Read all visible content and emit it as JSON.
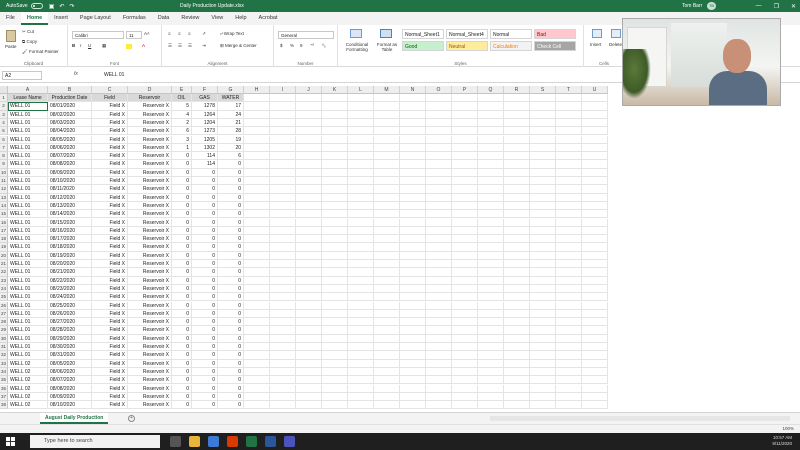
{
  "window": {
    "autosave_label": "AutoSave",
    "autosave_state": "Off",
    "doc_title": "Daily Production Update.xlsx",
    "user_name": "Tom Barr",
    "user_initials": "TB"
  },
  "menu": {
    "tabs": [
      "File",
      "Home",
      "Insert",
      "Page Layout",
      "Formulas",
      "Data",
      "Review",
      "View",
      "Help",
      "Acrobat"
    ],
    "active": "Home"
  },
  "ribbon": {
    "clipboard": {
      "paste": "Paste",
      "cut": "Cut",
      "copy": "Copy",
      "format_painter": "Format Painter",
      "label": "Clipboard"
    },
    "font": {
      "name": "Calibri",
      "size": "11",
      "label": "Font"
    },
    "alignment": {
      "wrap": "Wrap Text",
      "merge": "Merge & Center",
      "label": "Alignment"
    },
    "number": {
      "format": "General",
      "label": "Number"
    },
    "styles": {
      "conditional": "Conditional Formatting",
      "format_as_table": "Format as Table",
      "cells": [
        {
          "label": "Normal_Sheet1",
          "bg": "#ffffff",
          "fg": "#222222"
        },
        {
          "label": "Normal_Sheet4",
          "bg": "#ffffff",
          "fg": "#222222"
        },
        {
          "label": "Normal",
          "bg": "#ffffff",
          "fg": "#222222"
        },
        {
          "label": "Bad",
          "bg": "#ffc7ce",
          "fg": "#9c0006"
        },
        {
          "label": "Good",
          "bg": "#c6efce",
          "fg": "#006100"
        },
        {
          "label": "Neutral",
          "bg": "#ffeb9c",
          "fg": "#9c5700"
        },
        {
          "label": "Calculation",
          "bg": "#f2f2f2",
          "fg": "#fa7d00"
        },
        {
          "label": "Check Cell",
          "bg": "#a5a5a5",
          "fg": "#ffffff"
        }
      ],
      "label": "Styles"
    },
    "cells_group": {
      "insert": "Insert",
      "delete": "Delete",
      "label": "Cells"
    }
  },
  "formula_bar": {
    "name_box": "A2",
    "fx": "fx",
    "content": "WELL 01"
  },
  "sheet": {
    "columns": [
      "A",
      "B",
      "C",
      "D",
      "E",
      "F",
      "G",
      "H",
      "I",
      "J",
      "K",
      "L",
      "M",
      "N",
      "O",
      "P",
      "Q",
      "R",
      "S",
      "T",
      "U"
    ],
    "headers": [
      "Lease Name",
      "Production Date",
      "Field",
      "Reservoir",
      "OIL",
      "GAS",
      "WATER"
    ],
    "rows": [
      [
        "WELL 01",
        "08/01/2020",
        "Field X",
        "Reservoir X",
        "5",
        "1278",
        "17"
      ],
      [
        "WELL 01",
        "08/02/2020",
        "Field X",
        "Reservoir X",
        "4",
        "1264",
        "24"
      ],
      [
        "WELL 01",
        "08/03/2020",
        "Field X",
        "Reservoir X",
        "2",
        "1204",
        "21"
      ],
      [
        "WELL 01",
        "08/04/2020",
        "Field X",
        "Reservoir X",
        "6",
        "1273",
        "28"
      ],
      [
        "WELL 01",
        "08/05/2020",
        "Field X",
        "Reservoir X",
        "3",
        "1205",
        "19"
      ],
      [
        "WELL 01",
        "08/06/2020",
        "Field X",
        "Reservoir X",
        "1",
        "1302",
        "20"
      ],
      [
        "WELL 01",
        "08/07/2020",
        "Field X",
        "Reservoir X",
        "0",
        "114",
        "6"
      ],
      [
        "WELL 01",
        "08/08/2020",
        "Field X",
        "Reservoir X",
        "0",
        "114",
        "0"
      ],
      [
        "WELL 01",
        "08/09/2020",
        "Field X",
        "Reservoir X",
        "0",
        "0",
        "0"
      ],
      [
        "WELL 01",
        "08/10/2020",
        "Field X",
        "Reservoir X",
        "0",
        "0",
        "0"
      ],
      [
        "WELL 01",
        "08/11/2020",
        "Field X",
        "Reservoir X",
        "0",
        "0",
        "0"
      ],
      [
        "WELL 01",
        "08/12/2020",
        "Field X",
        "Reservoir X",
        "0",
        "0",
        "0"
      ],
      [
        "WELL 01",
        "08/13/2020",
        "Field X",
        "Reservoir X",
        "0",
        "0",
        "0"
      ],
      [
        "WELL 01",
        "08/14/2020",
        "Field X",
        "Reservoir X",
        "0",
        "0",
        "0"
      ],
      [
        "WELL 01",
        "08/15/2020",
        "Field X",
        "Reservoir X",
        "0",
        "0",
        "0"
      ],
      [
        "WELL 01",
        "08/16/2020",
        "Field X",
        "Reservoir X",
        "0",
        "0",
        "0"
      ],
      [
        "WELL 01",
        "08/17/2020",
        "Field X",
        "Reservoir X",
        "0",
        "0",
        "0"
      ],
      [
        "WELL 01",
        "08/18/2020",
        "Field X",
        "Reservoir X",
        "0",
        "0",
        "0"
      ],
      [
        "WELL 01",
        "08/19/2020",
        "Field X",
        "Reservoir X",
        "0",
        "0",
        "0"
      ],
      [
        "WELL 01",
        "08/20/2020",
        "Field X",
        "Reservoir X",
        "0",
        "0",
        "0"
      ],
      [
        "WELL 01",
        "08/21/2020",
        "Field X",
        "Reservoir X",
        "0",
        "0",
        "0"
      ],
      [
        "WELL 01",
        "08/22/2020",
        "Field X",
        "Reservoir X",
        "0",
        "0",
        "0"
      ],
      [
        "WELL 01",
        "08/23/2020",
        "Field X",
        "Reservoir X",
        "0",
        "0",
        "0"
      ],
      [
        "WELL 01",
        "08/24/2020",
        "Field X",
        "Reservoir X",
        "0",
        "0",
        "0"
      ],
      [
        "WELL 01",
        "08/25/2020",
        "Field X",
        "Reservoir X",
        "0",
        "0",
        "0"
      ],
      [
        "WELL 01",
        "08/26/2020",
        "Field X",
        "Reservoir X",
        "0",
        "0",
        "0"
      ],
      [
        "WELL 01",
        "08/27/2020",
        "Field X",
        "Reservoir X",
        "0",
        "0",
        "0"
      ],
      [
        "WELL 01",
        "08/28/2020",
        "Field X",
        "Reservoir X",
        "0",
        "0",
        "0"
      ],
      [
        "WELL 01",
        "08/29/2020",
        "Field X",
        "Reservoir X",
        "0",
        "0",
        "0"
      ],
      [
        "WELL 01",
        "08/30/2020",
        "Field X",
        "Reservoir X",
        "0",
        "0",
        "0"
      ],
      [
        "WELL 01",
        "08/31/2020",
        "Field X",
        "Reservoir X",
        "0",
        "0",
        "0"
      ],
      [
        "WELL 02",
        "08/05/2020",
        "Field X",
        "Reservoir X",
        "0",
        "0",
        "0"
      ],
      [
        "WELL 02",
        "08/06/2020",
        "Field X",
        "Reservoir X",
        "0",
        "0",
        "0"
      ],
      [
        "WELL 02",
        "08/07/2020",
        "Field X",
        "Reservoir X",
        "0",
        "0",
        "0"
      ],
      [
        "WELL 02",
        "08/08/2020",
        "Field X",
        "Reservoir X",
        "0",
        "0",
        "0"
      ],
      [
        "WELL 02",
        "08/09/2020",
        "Field X",
        "Reservoir X",
        "0",
        "0",
        "0"
      ],
      [
        "WELL 02",
        "08/10/2020",
        "Field X",
        "Reservoir X",
        "0",
        "0",
        "0"
      ]
    ]
  },
  "sheet_tabs": {
    "active": "August Daily Production",
    "add": "+"
  },
  "taskbar": {
    "search_placeholder": "Type here to search",
    "time": "10:57 AM",
    "date": "9/11/2020"
  },
  "status": {
    "zoom": "100%"
  }
}
